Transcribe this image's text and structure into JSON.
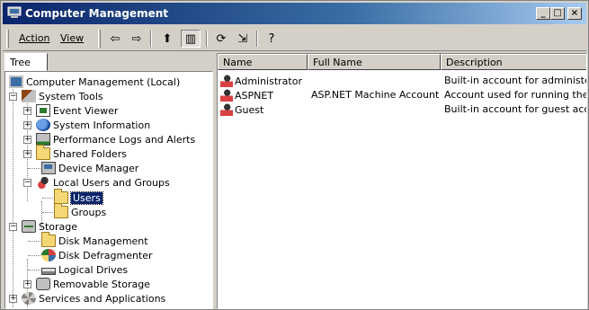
{
  "window": {
    "title": "Computer Management",
    "min_label": "_",
    "max_label": "□",
    "close_label": "×"
  },
  "toolbar": {
    "menu_action": "Action",
    "menu_view": "View",
    "back_icon": "⇦",
    "forward_icon": "⇨",
    "up_icon": "⬆",
    "show_tree_icon": "▥",
    "refresh_icon": "⟳",
    "export_icon": "⇲",
    "help_icon": "?"
  },
  "tree": {
    "tab_label": "Tree",
    "nodes": [
      {
        "label": "Computer Management (Local)",
        "icon": "computer-icon"
      },
      {
        "label": "System Tools",
        "icon": "tools-icon"
      },
      {
        "label": "Event Viewer",
        "icon": "event-viewer-icon"
      },
      {
        "label": "System Information",
        "icon": "system-info-icon"
      },
      {
        "label": "Performance Logs and Alerts",
        "icon": "performance-icon"
      },
      {
        "label": "Shared Folders",
        "icon": "shared-folders-icon"
      },
      {
        "label": "Device Manager",
        "icon": "device-manager-icon"
      },
      {
        "label": "Local Users and Groups",
        "icon": "users-groups-icon"
      },
      {
        "label": "Users",
        "icon": "folder-open-icon"
      },
      {
        "label": "Groups",
        "icon": "folder-icon"
      },
      {
        "label": "Storage",
        "icon": "storage-icon"
      },
      {
        "label": "Disk Management",
        "icon": "folder-icon"
      },
      {
        "label": "Disk Defragmenter",
        "icon": "defrag-icon"
      },
      {
        "label": "Logical Drives",
        "icon": "drive-icon"
      },
      {
        "label": "Removable Storage",
        "icon": "removable-storage-icon"
      },
      {
        "label": "Services and Applications",
        "icon": "services-icon"
      }
    ],
    "selected": "Users"
  },
  "list": {
    "columns": [
      "Name",
      "Full Name",
      "Description"
    ],
    "rows": [
      {
        "name": "Administrator",
        "full_name": "",
        "description": "Built-in account for administerir"
      },
      {
        "name": "ASPNET",
        "full_name": "ASP.NET Machine Account",
        "description": "Account used for running the A"
      },
      {
        "name": "Guest",
        "full_name": "",
        "description": "Built-in account for guest acce:"
      }
    ]
  },
  "colors": {
    "title_gradient_start": "#0a246a",
    "title_gradient_end": "#a6caf0",
    "face": "#d4d0c8",
    "selection": "#0a246a"
  }
}
